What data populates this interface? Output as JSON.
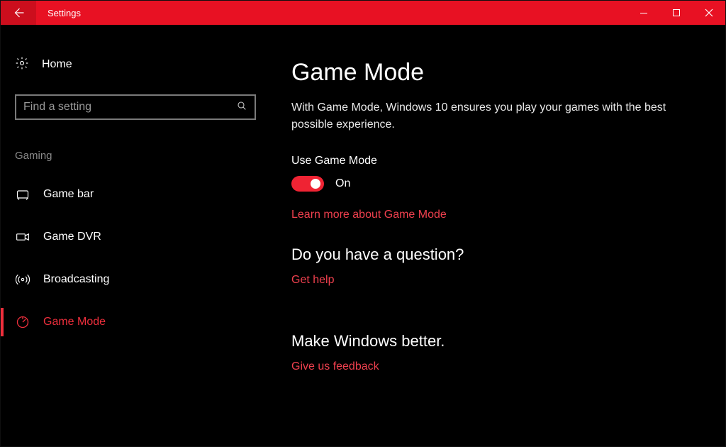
{
  "window": {
    "title": "Settings"
  },
  "sidebar": {
    "home": "Home",
    "search_placeholder": "Find a setting",
    "category": "Gaming",
    "items": [
      {
        "label": "Game bar"
      },
      {
        "label": "Game DVR"
      },
      {
        "label": "Broadcasting"
      },
      {
        "label": "Game Mode"
      }
    ]
  },
  "main": {
    "title": "Game Mode",
    "description": "With Game Mode, Windows 10 ensures you play your games with the best possible experience.",
    "toggle_label": "Use Game Mode",
    "toggle_state": "On",
    "learn_more": "Learn more about Game Mode",
    "question_heading": "Do you have a question?",
    "get_help": "Get help",
    "better_heading": "Make Windows better.",
    "feedback": "Give us feedback"
  }
}
